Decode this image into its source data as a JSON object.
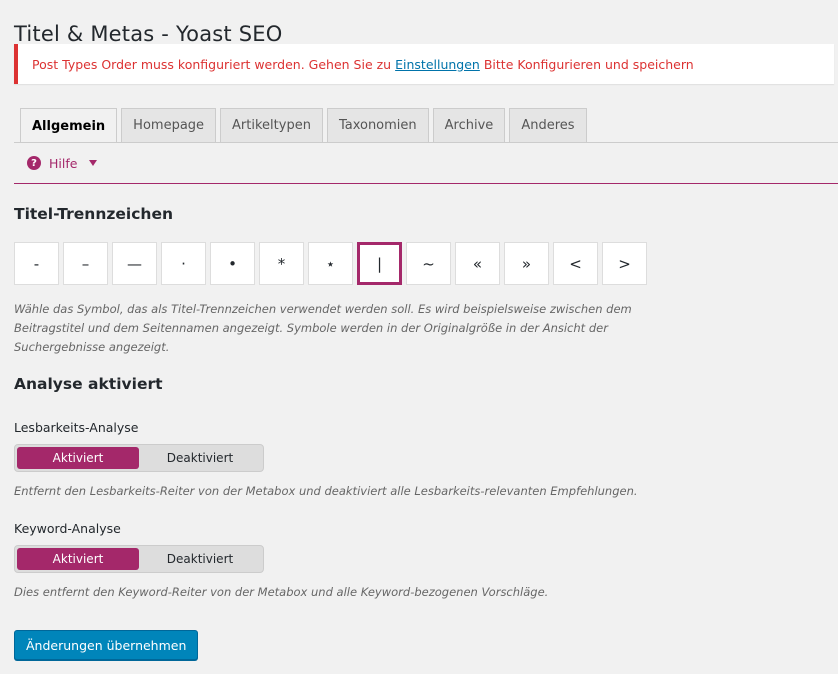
{
  "page": {
    "title": "Titel & Metas - Yoast SEO"
  },
  "notice": {
    "text_before": "Post Types Order muss konfiguriert werden. Gehen Sie zu",
    "link_label": "Einstellungen",
    "text_after": "Bitte Konfigurieren und speichern",
    "accent_color": "#dc3232"
  },
  "tabs": [
    {
      "label": "Allgemein",
      "active": true
    },
    {
      "label": "Homepage",
      "active": false
    },
    {
      "label": "Artikeltypen",
      "active": false
    },
    {
      "label": "Taxonomien",
      "active": false
    },
    {
      "label": "Archive",
      "active": false
    },
    {
      "label": "Anderes",
      "active": false
    }
  ],
  "help": {
    "icon": "question-circle-icon",
    "label": "Hilfe",
    "color": "#a4286a"
  },
  "separator_section": {
    "heading": "Titel-Trennzeichen",
    "options": [
      "-",
      "–",
      "—",
      "·",
      "•",
      "*",
      "⋆",
      "|",
      "~",
      "«",
      "»",
      "<",
      ">"
    ],
    "selected": "|",
    "description_lines": [
      "Wähle das Symbol, das als Titel-Trennzeichen verwendet werden soll. Es wird beispielsweise zwischen dem",
      "Beitragstitel und dem Seitennamen angezeigt. Symbole werden in der Originalgröße in der Ansicht der",
      "Suchergebnisse angezeigt."
    ]
  },
  "analysis_section": {
    "heading": "Analyse aktiviert",
    "readability": {
      "label": "Lesbarkeits-Analyse",
      "on_label": "Aktiviert",
      "off_label": "Deaktiviert",
      "value": "Aktiviert",
      "description": "Entfernt den Lesbarkeits-Reiter von der Metabox und deaktiviert alle Lesbarkeits-relevanten Empfehlungen."
    },
    "keyword": {
      "label": "Keyword-Analyse",
      "on_label": "Aktiviert",
      "off_label": "Deaktiviert",
      "value": "Aktiviert",
      "description": "Dies entfernt den Keyword-Reiter von der Metabox und alle Keyword-bezogenen Vorschläge."
    }
  },
  "submit": {
    "label": "Änderungen übernehmen",
    "color": "#0085ba"
  },
  "brand_color": "#a4286a"
}
